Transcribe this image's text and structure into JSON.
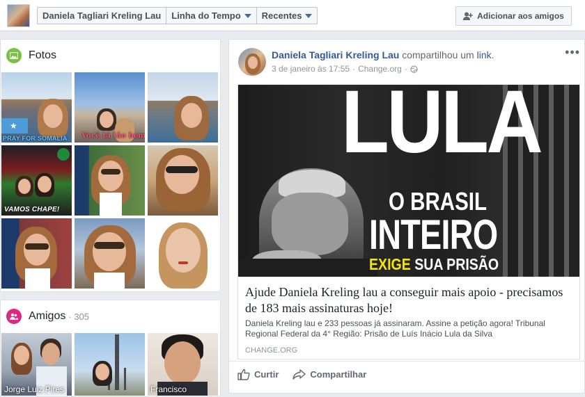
{
  "topbar": {
    "name_button": "Daniela Tagliari Kreling Lau",
    "timeline_button": "Linha do Tempo",
    "recent_button": "Recentes",
    "add_friend_button": "Adicionar aos amigos"
  },
  "photos": {
    "title": "Fotos",
    "captions": [
      "PRAY FOR SOMALIA",
      "Você tá tão bem",
      "VAMOS CHAPE!"
    ]
  },
  "friends": {
    "title": "Amigos",
    "count": "305",
    "names": [
      "Jorge Luiz Pires",
      "Francisco"
    ]
  },
  "post": {
    "author": "Daniela Tagliari Kreling Lau",
    "action_text": "compartilhou um",
    "link_word": "link",
    "date": "3 de janeiro às 17:55",
    "source": "Change.org",
    "image_text": {
      "line1": "LULA",
      "line2": "O BRASIL",
      "line3": "INTEIRO",
      "line4a": "EXIGE",
      "line4b": "SUA PRISÃO"
    },
    "share_title": "Ajude Daniela Kreling lau a conseguir mais apoio - precisamos de 183 mais assinaturas hoje!",
    "share_description": "Daniela Kreling lau e 233 pessoas já assinaram. Assine a petição agora! Tribunal Regional Federal da 4° Região: Prisão de Luís Inácio Lula da Silva",
    "share_domain": "CHANGE.ORG",
    "like_button": "Curtir",
    "share_button": "Compartilhar"
  },
  "colors": {
    "link_blue": "#365899",
    "photos_icon_bg": "#7ac143",
    "friends_icon_bg": "#e0277f"
  }
}
